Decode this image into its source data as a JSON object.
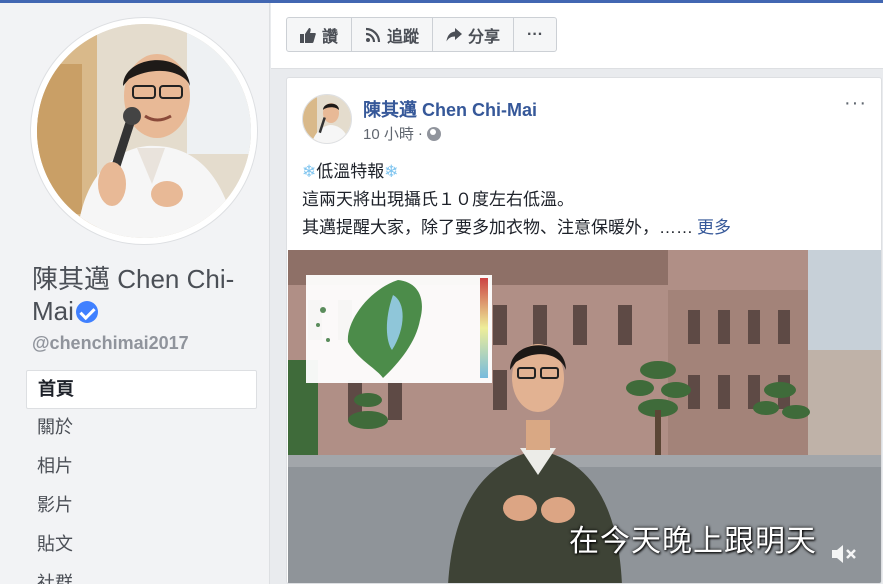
{
  "page": {
    "name": "陳其邁 Chen Chi-Mai",
    "handle": "@chenchimai2017",
    "nav": [
      "首頁",
      "關於",
      "相片",
      "影片",
      "貼文",
      "社群"
    ]
  },
  "actions": {
    "like": "讚",
    "follow": "追蹤",
    "share": "分享",
    "more": "···"
  },
  "post": {
    "author": "陳其邁 Chen Chi-Mai",
    "time": "10 小時",
    "heading_snow_left": "❄",
    "heading": "低溫特報",
    "heading_snow_right": "❄",
    "line1": "這兩天將出現攝氏１０度左右低溫。",
    "line2": "其邁提醒大家，除了要多加衣物、注意保暖外，……",
    "see_more": "更多",
    "more_menu": "···",
    "video_caption": "在今天晚上跟明天"
  },
  "colors": {
    "accent": "#4267b2",
    "link": "#365899",
    "verified": "#4080ff"
  }
}
